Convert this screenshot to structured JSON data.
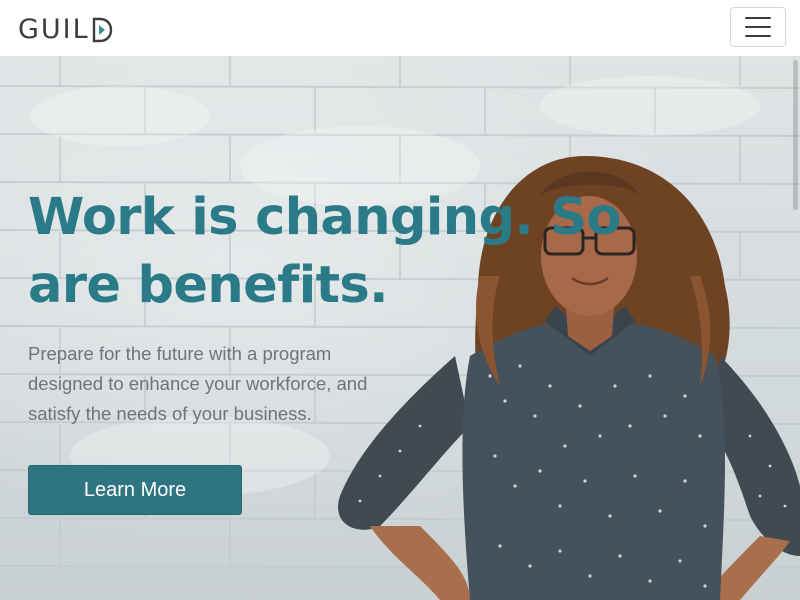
{
  "header": {
    "logo_text": "GUIL",
    "logo_mark_letter": "D",
    "menu_icon": "hamburger-icon"
  },
  "hero": {
    "headline": "Work is changing. So are benefits.",
    "subtext": "Prepare for the future with a program designed to enhance your workforce, and satisfy the needs of your business.",
    "cta_label": "Learn More",
    "image": "woman-standing-hands-on-hips-photo"
  },
  "colors": {
    "accent": "#2a7a88",
    "button": "#2e7581",
    "logo_text": "#3a3d42",
    "logo_triangle": "#3c8f9c",
    "subtext": "#6f7477"
  }
}
